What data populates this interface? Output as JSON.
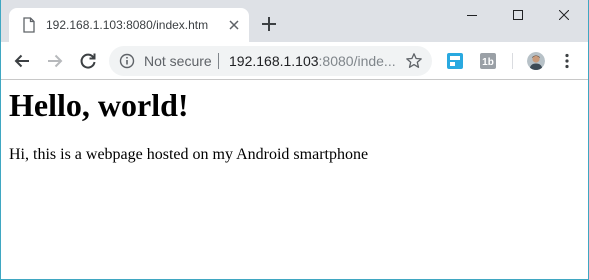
{
  "tab": {
    "title": "192.168.1.103:8080/index.htm"
  },
  "toolbar": {
    "security_label": "Not secure",
    "url_host": "192.168.1.103",
    "url_rest": ":8080/inde..."
  },
  "page": {
    "heading": "Hello, world!",
    "paragraph": "Hi, this is a webpage hosted on my Android smartphone"
  },
  "colors": {
    "tabstrip": "#dee1e6",
    "window_border": "#3fa7c2",
    "omnibox": "#f1f3f4"
  },
  "icons": [
    "page-icon",
    "close-icon",
    "plus-icon",
    "minimize-icon",
    "maximize-icon",
    "window-close-icon",
    "back-arrow-icon",
    "forward-arrow-icon",
    "reload-icon",
    "info-icon",
    "star-icon",
    "extension-tile-icon",
    "extension-1b-icon",
    "avatar",
    "more-vert-icon"
  ]
}
